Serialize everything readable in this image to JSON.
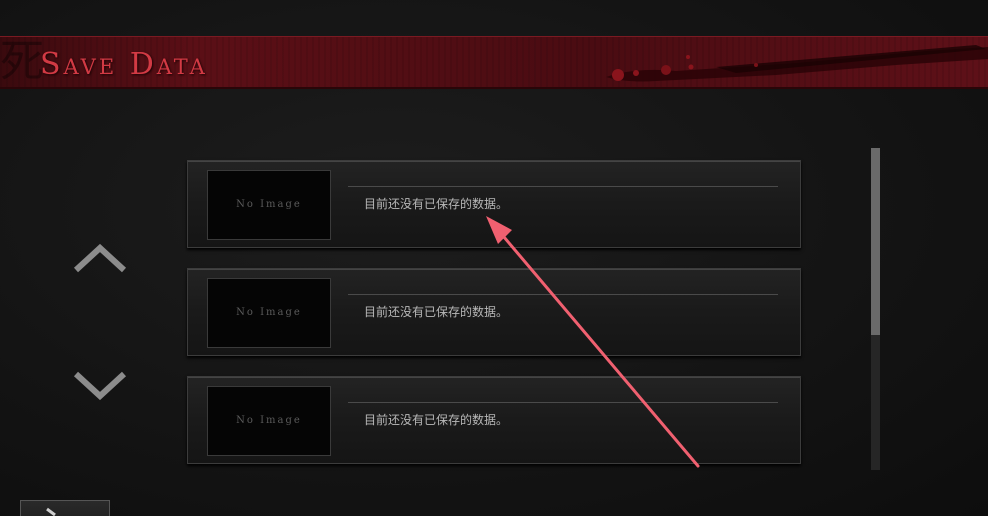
{
  "header": {
    "title": "Save Data",
    "watermark_glyph": "死"
  },
  "navigation": {
    "up_icon": "chevron-up-icon",
    "down_icon": "chevron-down-icon"
  },
  "slots": [
    {
      "thumbnail_text": "No Image",
      "status_text": "目前还没有已保存的数据。"
    },
    {
      "thumbnail_text": "No Image",
      "status_text": "目前还没有已保存的数据。"
    },
    {
      "thumbnail_text": "No Image",
      "status_text": "目前还没有已保存的数据。"
    }
  ],
  "scrollbar": {
    "visible_fraction": 0.58,
    "position": 0.0
  },
  "back_button": {
    "icon": "back-arrow-icon"
  },
  "colors": {
    "title_red": "#d23a44",
    "banner_red": "#5b0f16",
    "annotation_arrow": "#f06070"
  }
}
